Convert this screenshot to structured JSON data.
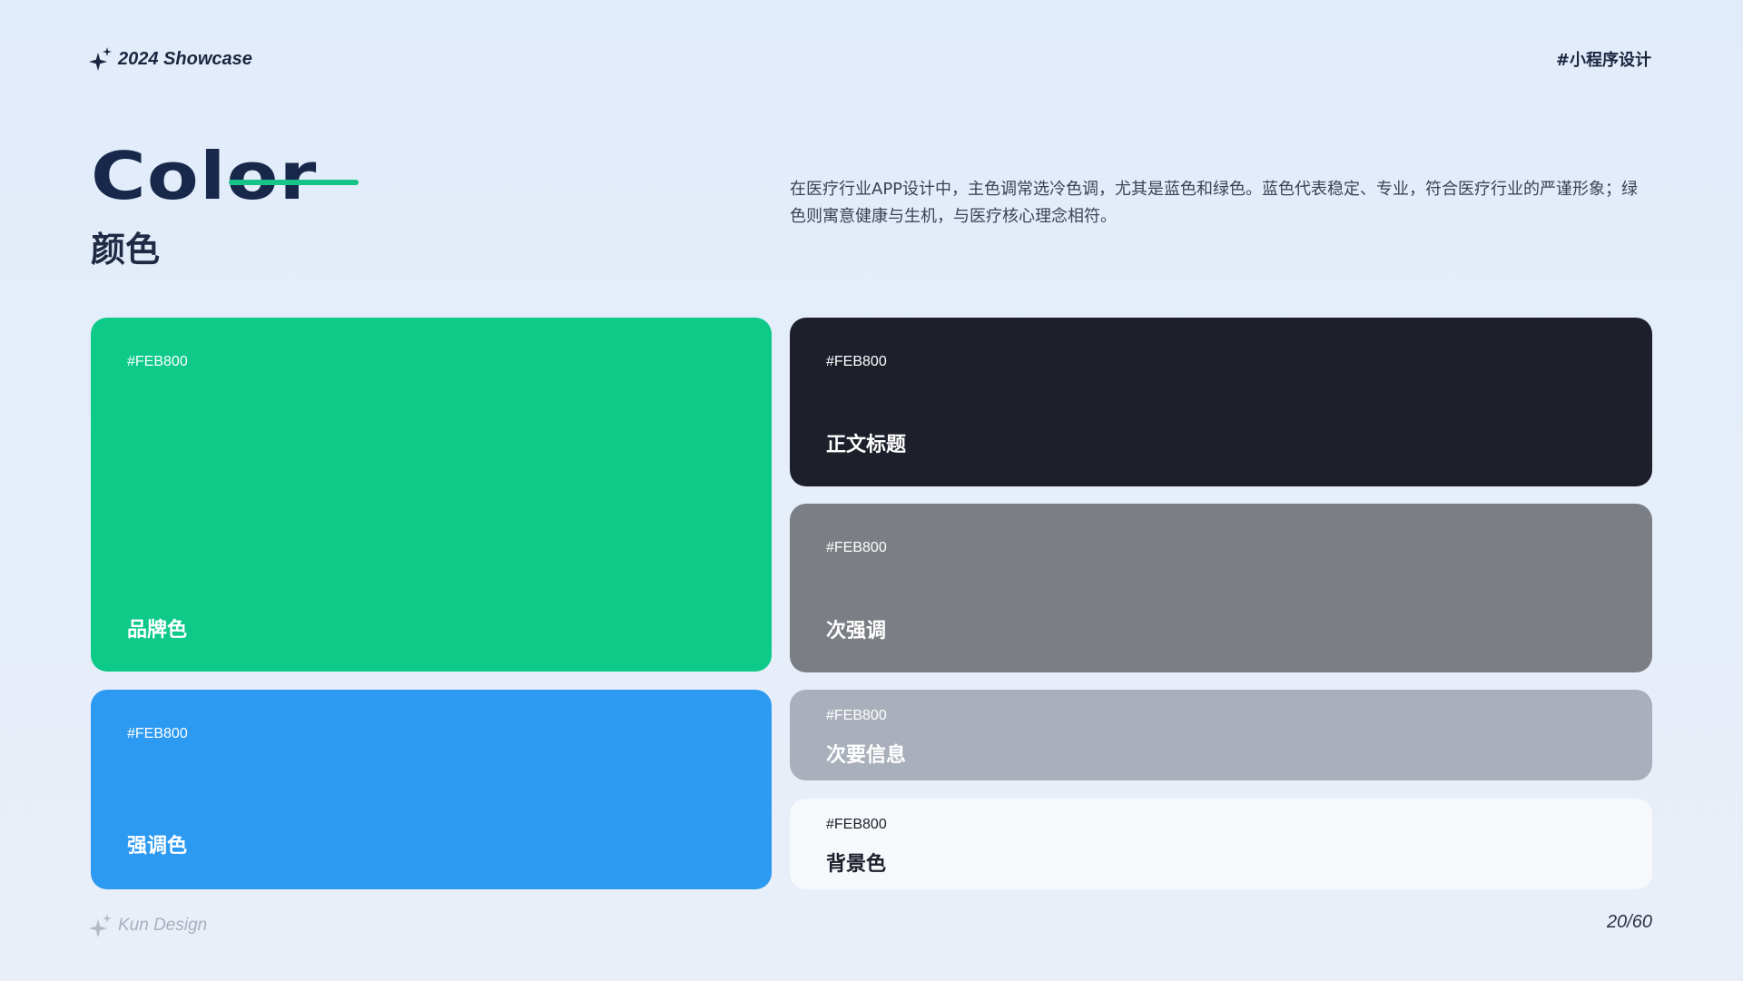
{
  "header": {
    "brand_text": "2024 Showcase",
    "tag": "#小程序设计",
    "spark_icon": "sparkle-icon"
  },
  "title": {
    "english": "Color",
    "chinese": "颜色",
    "accent_color": "#17c386"
  },
  "description": "在医疗行业APP设计中，主色调常选冷色调，尤其是蓝色和绿色。蓝色代表稳定、专业，符合医疗行业的严谨形象；绿色则寓意健康与生机，与医疗核心理念相符。",
  "swatches": [
    {
      "hex_label": "#FEB800",
      "name": "品牌色",
      "color": "#0dca89"
    },
    {
      "hex_label": "#FEB800",
      "name": "强调色",
      "color": "#2d9af2"
    },
    {
      "hex_label": "#FEB800",
      "name": "正文标题",
      "color": "#1d202b"
    },
    {
      "hex_label": "#FEB800",
      "name": "次强调",
      "color": "#7b7e84"
    },
    {
      "hex_label": "#FEB800",
      "name": "次要信息",
      "color": "#aab0bb"
    },
    {
      "hex_label": "#FEB800",
      "name": "背景色",
      "color": "#f6f8fb"
    }
  ],
  "footer": {
    "brand_text": "Kun Design",
    "page": "20/60",
    "spark_icon": "sparkle-icon"
  }
}
